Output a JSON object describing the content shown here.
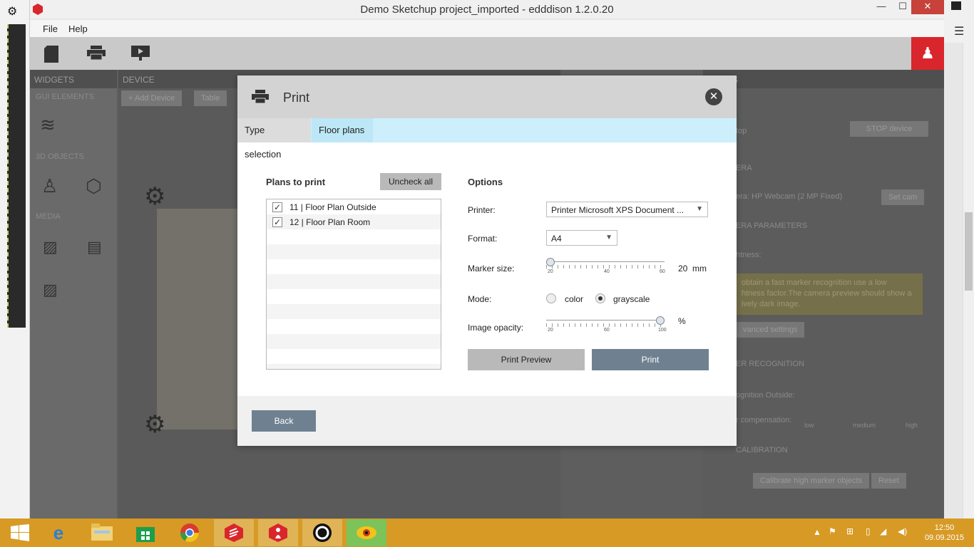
{
  "window": {
    "title": "Demo Sketchup project_imported  -  edddison 1.2.0.20",
    "minimize": "—",
    "maximize": "☐",
    "close": "✕"
  },
  "menu": {
    "file": "File",
    "help": "Help"
  },
  "background": {
    "panels": {
      "widgets": "WIDGETS",
      "device": "DEVICE",
      "properties": "ERTIES"
    },
    "sections": {
      "gui": "GUI ELEMENTS",
      "objects3d": "3D OBJECTS",
      "media": "MEDIA"
    },
    "add_device": "+ Add Device",
    "table": "Table",
    "stop_label": "top",
    "stop_device": "STOP device",
    "camera_section": "ERA",
    "camera_label": "era:   HP Webcam (2 MP Fixed)",
    "set_cam": "Set cam",
    "camera_params": "ERA PARAMETERS",
    "brightness": "htness:",
    "warning": "obtain a fast marker recognition use a low\nhtness factor.The camera preview should show a\nively dark image.",
    "advanced": "vanced settings",
    "marker_recognition": "ER RECOGNITION",
    "recognition_outside": "ognition Outside:",
    "compensation": "r compensation:",
    "low": "low",
    "medium": "medium",
    "high": "high",
    "calibration": "CALIBRATION",
    "calibrate_btn": "Calibrate high marker objects",
    "reset_btn": "Reset"
  },
  "dialog": {
    "title": "Print",
    "close_icon": "✕",
    "tabs": {
      "type_selection": "Type selection",
      "floor_plans": "Floor plans"
    },
    "plans_to_print": "Plans to print",
    "uncheck_all": "Uncheck all",
    "plans": [
      {
        "label": "11 | Floor Plan Outside",
        "checked": true
      },
      {
        "label": "12 | Floor Plan Room",
        "checked": true
      }
    ],
    "options_title": "Options",
    "printer_label": "Printer:",
    "printer_value": "Printer Microsoft XPS Document ...",
    "format_label": "Format:",
    "format_value": "A4",
    "marker_size_label": "Marker size:",
    "marker_size_value": "20",
    "marker_size_unit": "mm",
    "marker_scale": {
      "min": "20",
      "mid": "40",
      "max": "60"
    },
    "marker_size_fraction": 0.0,
    "mode_label": "Mode:",
    "mode_color": "color",
    "mode_grayscale": "grayscale",
    "mode_selected": "grayscale",
    "opacity_label": "Image opacity:",
    "opacity_unit": "%",
    "opacity_scale": {
      "min": "20",
      "mid": "60",
      "max": "100"
    },
    "opacity_fraction": 1.0,
    "print_preview": "Print Preview",
    "print": "Print",
    "back": "Back"
  },
  "taskbar": {
    "time": "12:50",
    "date": "09.09.2015"
  }
}
